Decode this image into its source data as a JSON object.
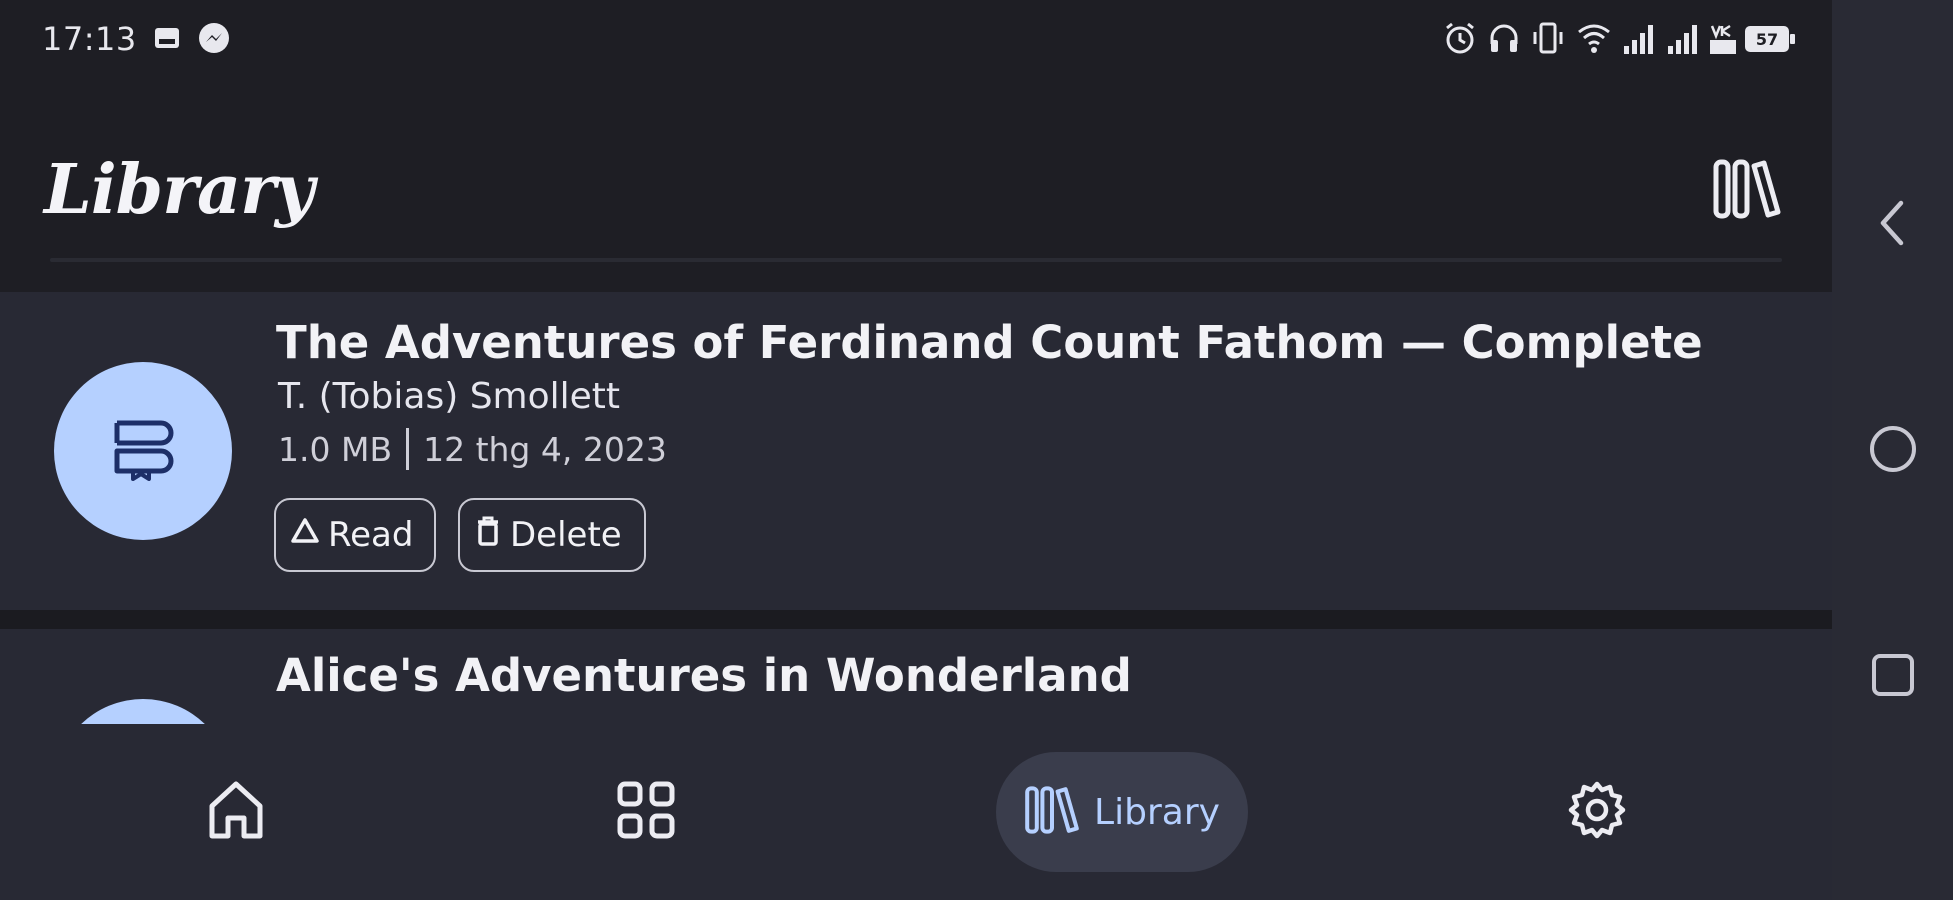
{
  "status_bar": {
    "time": "17:13",
    "battery": "57",
    "icons": [
      "image-icon",
      "messenger-icon",
      "alarm-icon",
      "headphones-icon",
      "vibrate-icon",
      "wifi-icon",
      "signal-icon",
      "signal-icon",
      "data-icon",
      "battery-icon"
    ]
  },
  "header": {
    "title": "Library",
    "action_icon": "library-icon"
  },
  "books": [
    {
      "title": "The Adventures of Ferdinand Count Fathom — Complete",
      "author": "T. (Tobias) Smollett",
      "size": "1.0 MB",
      "date": "12 thg 4, 2023",
      "read_label": "Read",
      "delete_label": "Delete",
      "icon": "book-icon"
    },
    {
      "title": "Alice's Adventures in Wonderland"
    }
  ],
  "bottom_nav": {
    "items": [
      {
        "icon": "home-icon"
      },
      {
        "icon": "browse-grid-icon"
      },
      {
        "icon": "library-icon",
        "label": "Library",
        "active": true
      },
      {
        "icon": "gear-icon"
      }
    ]
  },
  "system_nav": [
    "back-icon",
    "home-circle-icon",
    "recents-icon"
  ],
  "colors": {
    "background": "#1e1e24",
    "card": "#282934",
    "accent": "#b5d0ff",
    "active_pill": "#3a3d4c",
    "text": "#f2f2f6"
  }
}
